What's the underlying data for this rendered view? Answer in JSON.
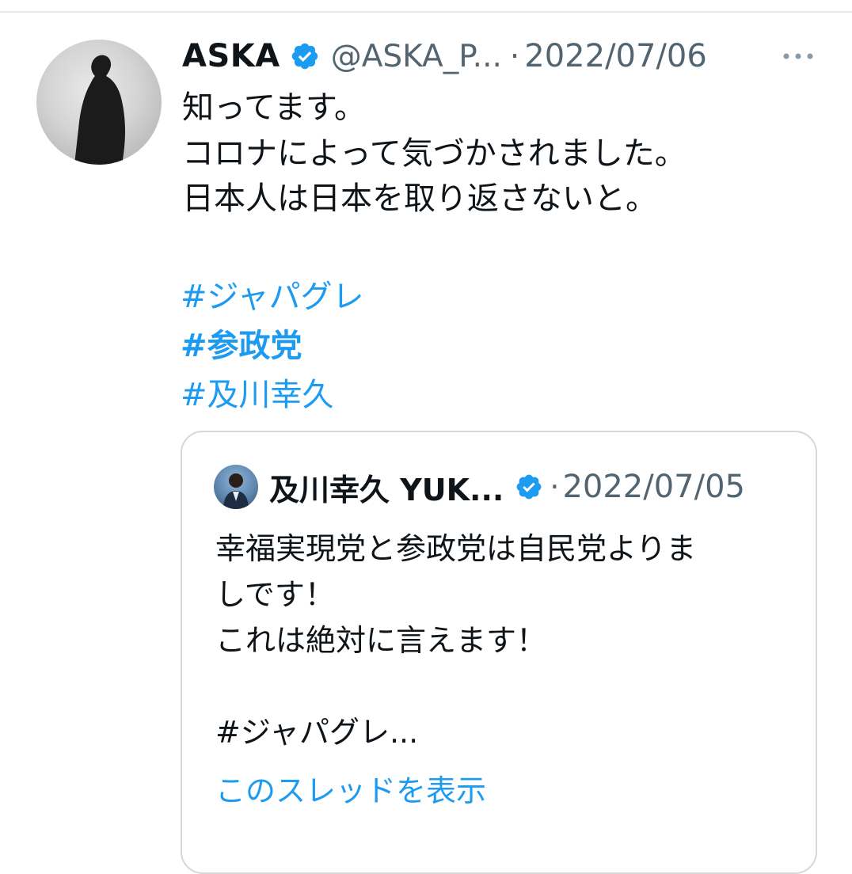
{
  "tweet": {
    "author_name": "ASKA",
    "handle": "@ASKA_P...",
    "separator": "·",
    "date": "2022/07/06",
    "text": "知ってます。\nコロナによって気づかされました。\n日本人は日本を取り返さないと。",
    "hashtags": [
      "#ジャパグレ",
      "#参政党",
      "#及川幸久"
    ]
  },
  "quoted": {
    "author_name": "及川幸久 YUK...",
    "separator": "·",
    "date": "2022/07/05",
    "text": "幸福実現党と参政党は自民党よりま\nしです！\nこれは絶対に言えます！\n\n#ジャパグレ...",
    "show_thread": "このスレッドを表示"
  },
  "colors": {
    "link": "#1d9bf0",
    "secondary_text": "#536471",
    "border": "#cfd9de"
  },
  "icons": {
    "verified": "verified-badge-icon",
    "more": "more-options-icon"
  }
}
